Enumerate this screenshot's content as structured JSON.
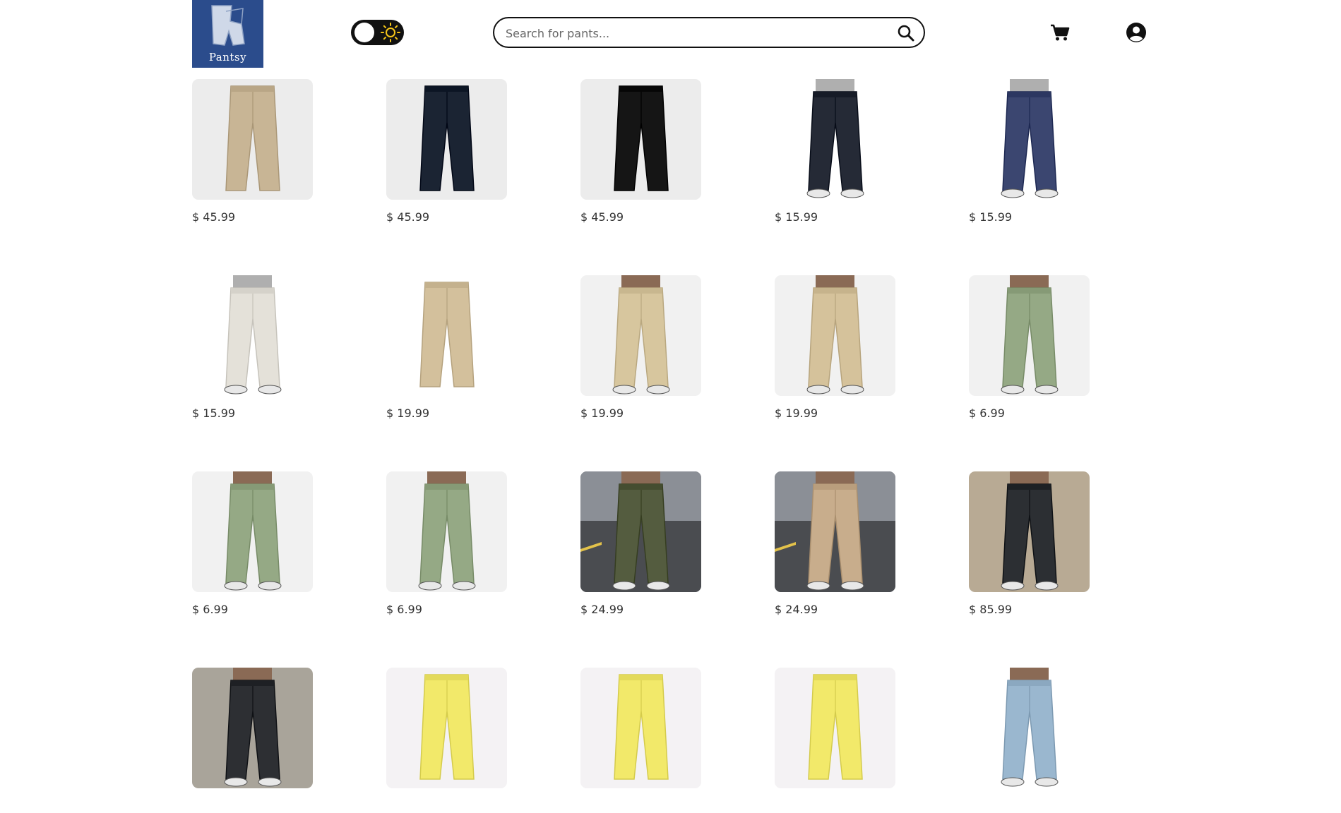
{
  "brand": {
    "name": "Pantsy",
    "color": "#2b4c8c"
  },
  "search": {
    "placeholder": "Search for pants...",
    "value": ""
  },
  "header": {
    "theme_toggle_state": "light",
    "icons": [
      "sun-icon",
      "search-icon",
      "cart-icon",
      "account-icon"
    ]
  },
  "products": [
    {
      "price": "$ 45.99",
      "color": "#c8b595",
      "bg": "#ececec",
      "style": "flat"
    },
    {
      "price": "$ 45.99",
      "color": "#1b2433",
      "bg": "#ececec",
      "style": "flat"
    },
    {
      "price": "$ 45.99",
      "color": "#151515",
      "bg": "#ececec",
      "style": "flat"
    },
    {
      "price": "$ 15.99",
      "color": "#252a36",
      "bg": "#ffffff",
      "style": "worn"
    },
    {
      "price": "$ 15.99",
      "color": "#3b4670",
      "bg": "#ffffff",
      "style": "worn"
    },
    {
      "price": "$ 15.99",
      "color": "#e4e1d9",
      "bg": "#ffffff",
      "style": "worn"
    },
    {
      "price": "$ 19.99",
      "color": "#d3c09c",
      "bg": "#ffffff",
      "style": "flat"
    },
    {
      "price": "$ 19.99",
      "color": "#d7c69e",
      "bg": "#f1f1f1",
      "style": "model"
    },
    {
      "price": "$ 19.99",
      "color": "#d5c29b",
      "bg": "#f1f1f1",
      "style": "model"
    },
    {
      "price": "$ 6.99",
      "color": "#95a985",
      "bg": "#f1f1f1",
      "style": "model"
    },
    {
      "price": "$ 6.99",
      "color": "#95a985",
      "bg": "#f1f1f1",
      "style": "model"
    },
    {
      "price": "$ 6.99",
      "color": "#95a985",
      "bg": "#f1f1f1",
      "style": "model"
    },
    {
      "price": "$ 24.99",
      "color": "#545c3f",
      "bg": "#5b5e62",
      "style": "street"
    },
    {
      "price": "$ 24.99",
      "color": "#c8ad8c",
      "bg": "#5b5e62",
      "style": "street"
    },
    {
      "price": "$ 85.99",
      "color": "#2c2f33",
      "bg": "#b8aa94",
      "style": "model"
    },
    {
      "price": "",
      "color": "#2d2f33",
      "bg": "#a9a49a",
      "style": "model"
    },
    {
      "price": "",
      "color": "#f2e96a",
      "bg": "#f4f2f4",
      "style": "flat"
    },
    {
      "price": "",
      "color": "#f2e96a",
      "bg": "#f4f2f4",
      "style": "flat"
    },
    {
      "price": "",
      "color": "#f2e96a",
      "bg": "#f4f2f4",
      "style": "flat"
    },
    {
      "price": "",
      "color": "#9ab7cf",
      "bg": "#ffffff",
      "style": "model"
    }
  ]
}
